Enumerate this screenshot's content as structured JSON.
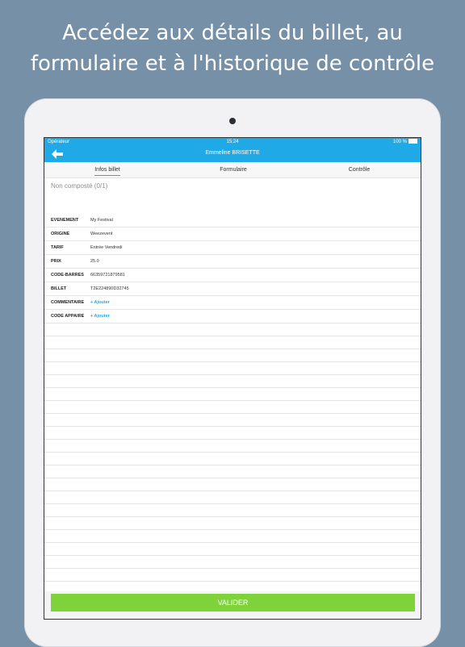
{
  "headline": {
    "line1": "Accédez aux détails du billet, au",
    "line2": "formulaire et à l'historique de contrôle"
  },
  "statusbar": {
    "carrier": "Opérateur",
    "time": "15:24",
    "battery": "100 %"
  },
  "navbar": {
    "back_icon": "arrow-left-icon",
    "title": "Emmeline BRISETTE"
  },
  "tabs": [
    {
      "label": "Infos billet",
      "active": true
    },
    {
      "label": "Formulaire",
      "active": false
    },
    {
      "label": "Contrôle",
      "active": false
    }
  ],
  "composed_text": "Non composté (0/1)",
  "details": [
    {
      "label": "EVENEMENT",
      "value": "My Festival"
    },
    {
      "label": "ORIGINE",
      "value": "Weezevent"
    },
    {
      "label": "TARIF",
      "value": "Entrée Vendredi"
    },
    {
      "label": "PRIX",
      "value": "25.0"
    },
    {
      "label": "CODE-BARRES",
      "value": "66359721879581"
    },
    {
      "label": "BILLET",
      "value": "T2E224890D32745"
    },
    {
      "label": "COMMENTAIRE",
      "value": "+ Ajouter"
    },
    {
      "label": "CODE APPAIRE",
      "value": "+ Ajouter"
    }
  ],
  "footer": {
    "valider_label": "VALIDER"
  },
  "colors": {
    "background": "#7590a7",
    "accent": "#1fa9e6",
    "valider": "#7ed23a"
  }
}
